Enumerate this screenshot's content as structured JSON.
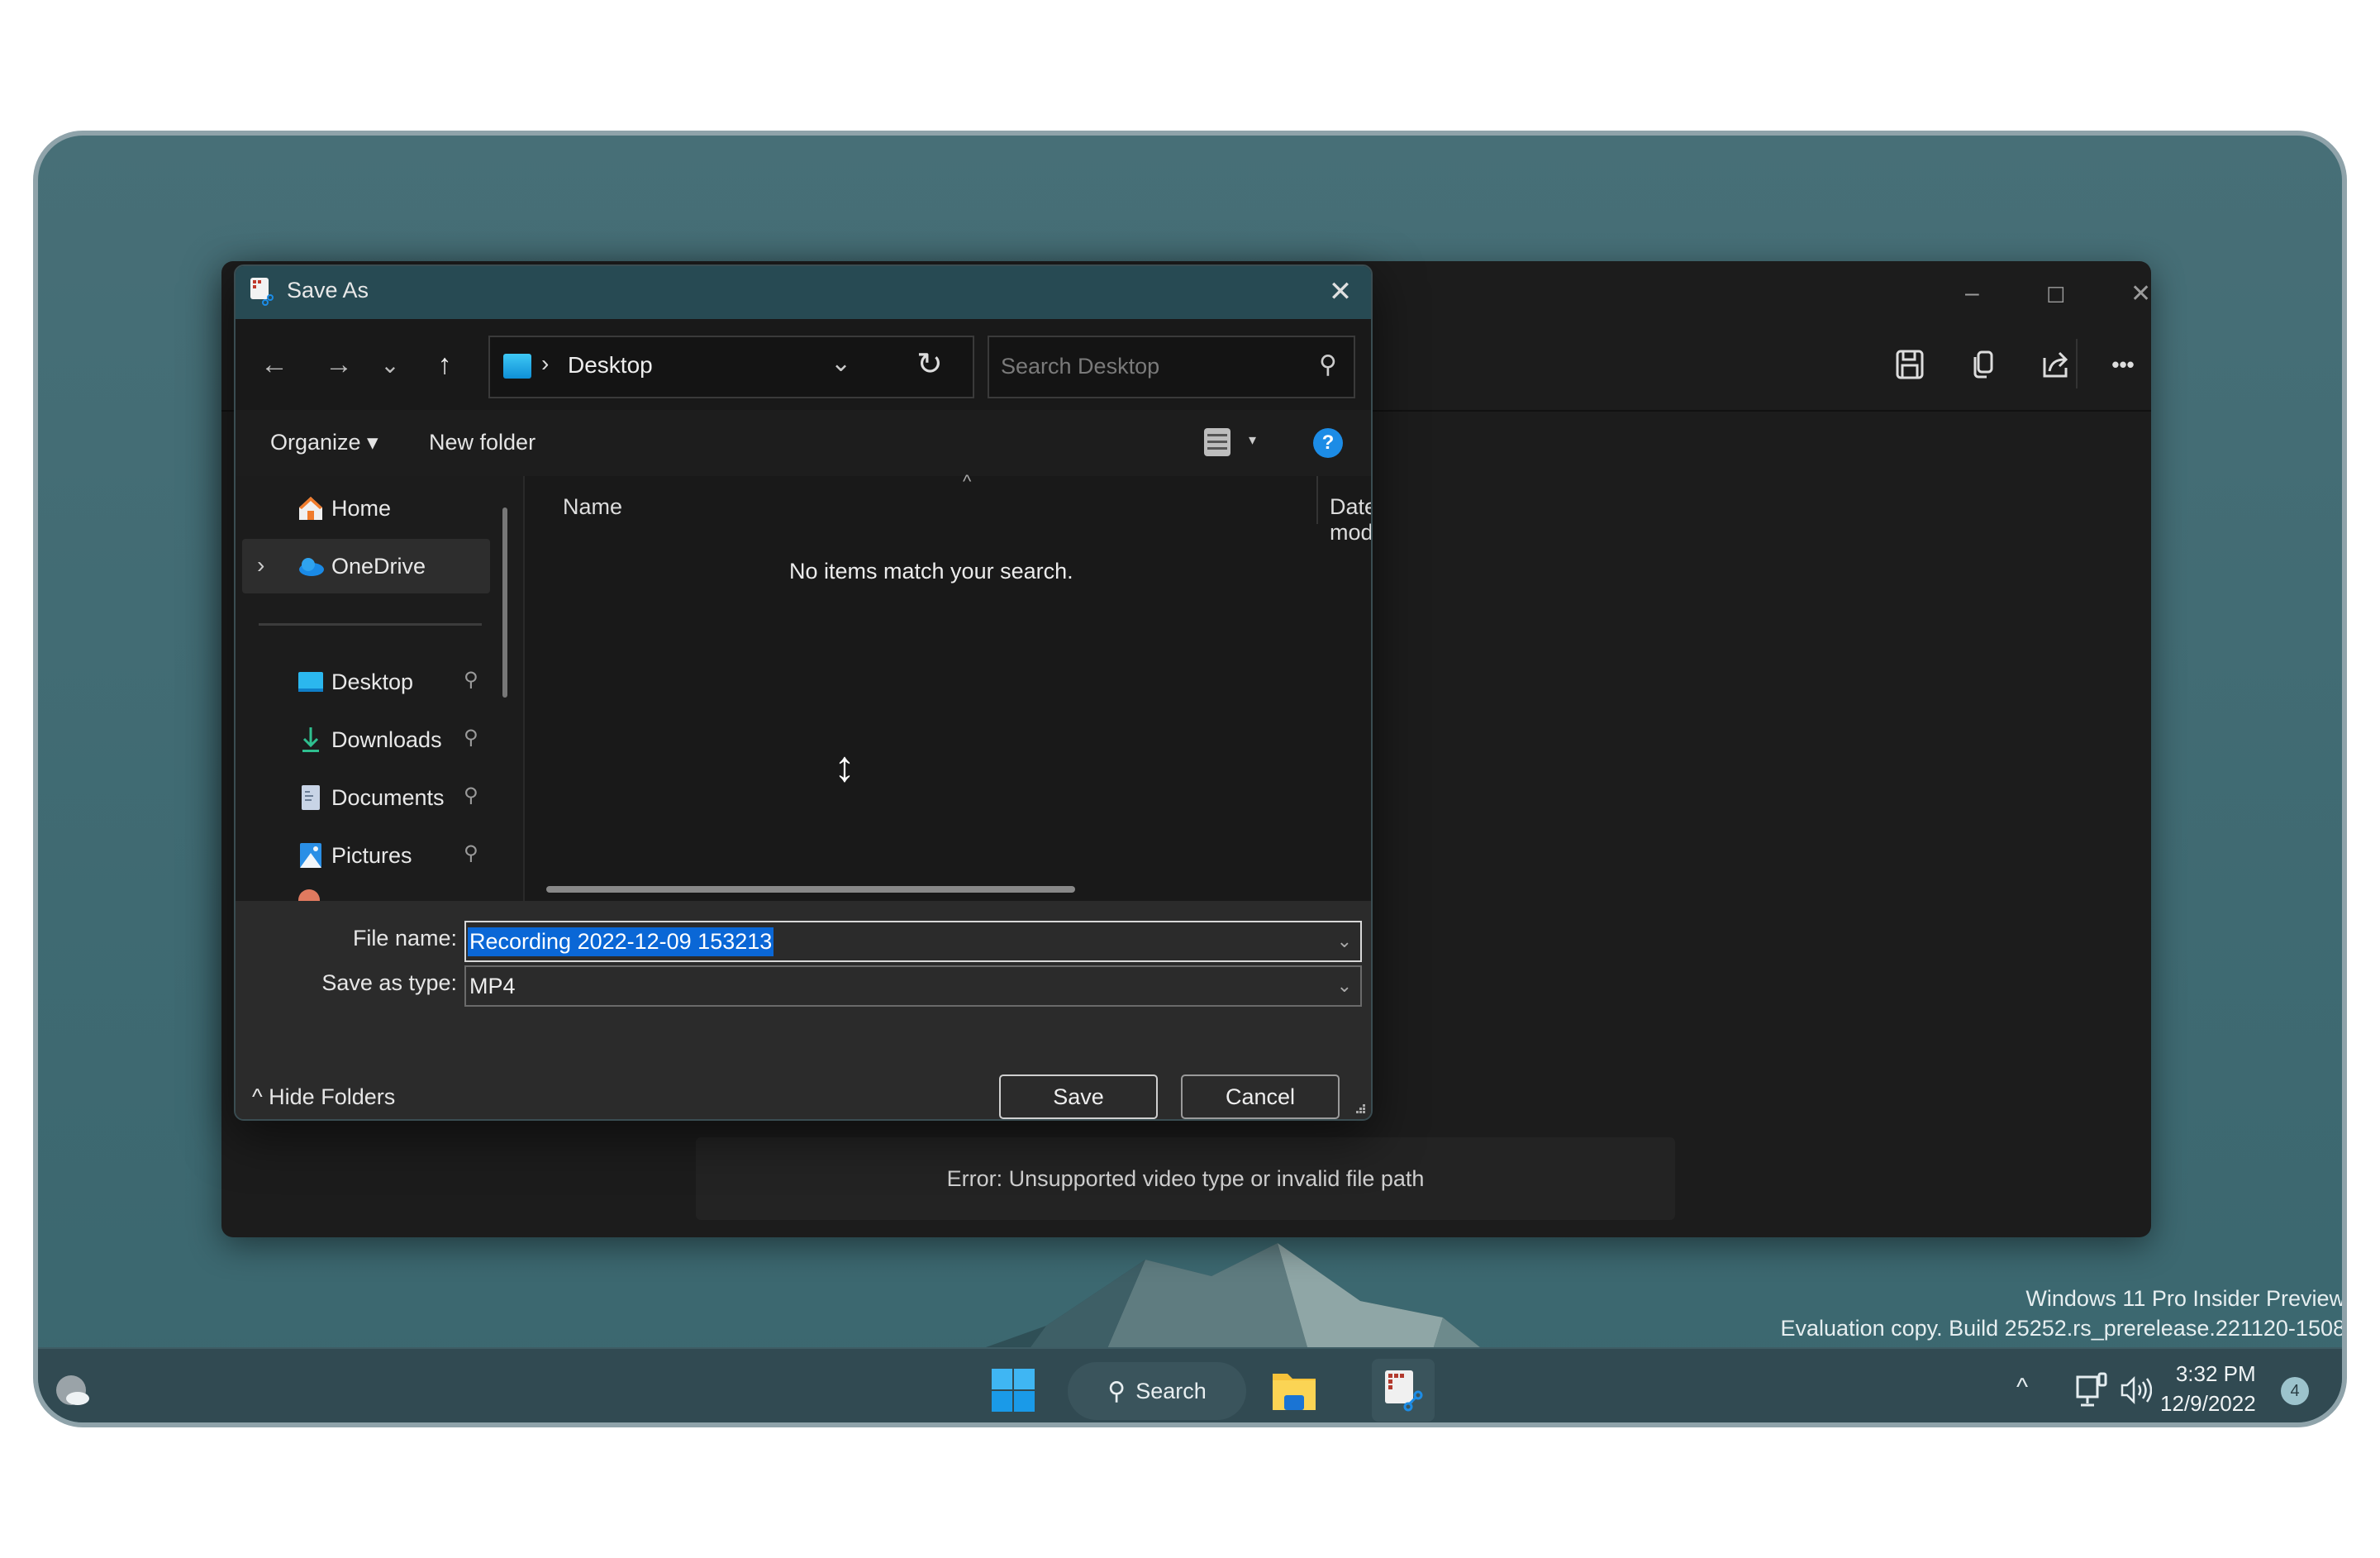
{
  "desktop": {
    "watermark_line1": "Windows 11 Pro Insider Preview",
    "watermark_line2": "Evaluation copy. Build 25252.rs_prerelease.221120-1508"
  },
  "app_window": {
    "controls": {
      "minimize": "–",
      "maximize": "☐",
      "close": "✕"
    },
    "toolbar": [
      "save-icon",
      "copy-icon",
      "share-icon",
      "more-icon"
    ],
    "more_label": "•••",
    "error_message": "Error: Unsupported video type or invalid file path"
  },
  "dialog": {
    "title": "Save As",
    "close": "✕",
    "nav": {
      "back": "←",
      "forward": "→",
      "recent": "⌄",
      "up": "↑"
    },
    "address": {
      "separator": "›",
      "location": "Desktop",
      "dropdown": "⌄",
      "refresh": "↻"
    },
    "search_placeholder": "Search Desktop",
    "search_icon": "⚲",
    "commands": {
      "organize": "Organize ▾",
      "new_folder": "New folder",
      "view_dropdown": "▾",
      "help": "?"
    },
    "nav_pane": {
      "expand_chevron": "›",
      "pin": "📌",
      "items": [
        {
          "label": "Home",
          "icon": "home-icon"
        },
        {
          "label": "OneDrive",
          "icon": "onedrive-icon",
          "selected": true,
          "expandable": true
        },
        {
          "label": "Desktop",
          "icon": "desktop-folder-icon",
          "pinned": true
        },
        {
          "label": "Downloads",
          "icon": "downloads-icon",
          "pinned": true
        },
        {
          "label": "Documents",
          "icon": "documents-icon",
          "pinned": true
        },
        {
          "label": "Pictures",
          "icon": "pictures-icon",
          "pinned": true
        }
      ]
    },
    "columns": {
      "name": "Name",
      "date_modified": "Date modified",
      "sort_caret": "^"
    },
    "empty_message": "No items match your search.",
    "cursor": "↕",
    "form": {
      "file_name_label": "File name:",
      "file_name_value": "Recording 2022-12-09 153213",
      "save_type_label": "Save as type:",
      "save_type_value": "MP4",
      "dropdown": "⌄"
    },
    "hide_folders": "^ Hide Folders",
    "save_label": "Save",
    "cancel_label": "Cancel"
  },
  "taskbar": {
    "search_label": "Search",
    "search_icon": "⚲",
    "tray_chevron": "^",
    "time": "3:32 PM",
    "date": "12/9/2022",
    "notification_count": "4"
  },
  "colors": {
    "accent": "#0a67d6",
    "help_blue": "#1c8ce6",
    "title_bar": "#274a53",
    "taskbar": "#314a52"
  }
}
